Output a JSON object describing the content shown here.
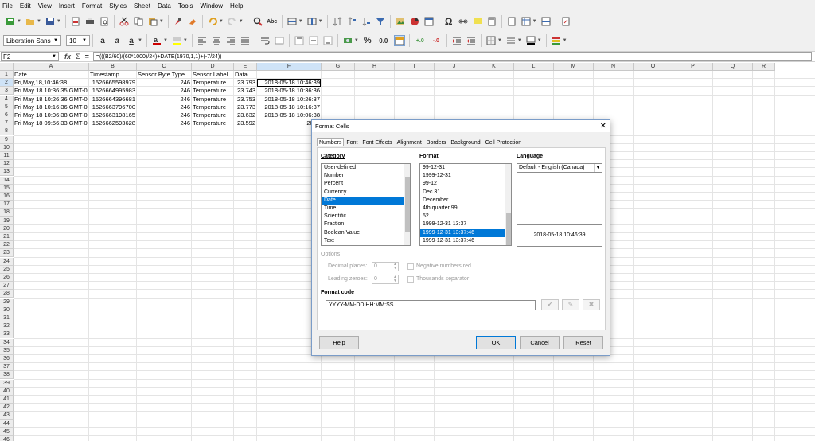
{
  "menu": [
    "File",
    "Edit",
    "View",
    "Insert",
    "Format",
    "Styles",
    "Sheet",
    "Data",
    "Tools",
    "Window",
    "Help"
  ],
  "toolbar": {
    "font_name": "Liberation Sans",
    "font_size": "10",
    "omega": "Ω",
    "percent": "%",
    "decimal": "0.0"
  },
  "formula_bar": {
    "cell_ref": "F2",
    "func_icon": "fx",
    "sum_icon": "Σ",
    "equals_icon": "=",
    "formula": "=(((B2/60)/(60*1000)/24)+DATE(1970,1,1)+(-7/24))"
  },
  "columns": [
    "A",
    "B",
    "C",
    "D",
    "E",
    "F",
    "G",
    "H",
    "I",
    "J",
    "K",
    "L",
    "M",
    "N",
    "O",
    "P",
    "Q",
    "R"
  ],
  "rows": [
    "1",
    "2",
    "3",
    "4",
    "5",
    "6",
    "7",
    "8",
    "9",
    "10",
    "11",
    "12",
    "13",
    "14",
    "15",
    "16",
    "17",
    "18",
    "19",
    "20",
    "21",
    "22",
    "23",
    "24",
    "25",
    "26",
    "27",
    "28",
    "29",
    "30",
    "31",
    "32",
    "33",
    "34",
    "35",
    "36",
    "37",
    "38",
    "39",
    "40",
    "41",
    "42",
    "43",
    "44",
    "45",
    "46"
  ],
  "sheet": {
    "headers": [
      "Date",
      "Timestamp",
      "Sensor Byte Type",
      "Sensor Label",
      "Data"
    ],
    "data": [
      [
        "Fri,May,18,10:46:38",
        "1526665598979",
        "246",
        "Temperature",
        "23.793",
        "2018-05-18 10:46:39"
      ],
      [
        "Fri May 18 10:36:35 GMT-0700 2018",
        "1526664995983",
        "246",
        "Temperature",
        "23.743",
        "2018-05-18 10:36:36"
      ],
      [
        "Fri May 18 10:26:36 GMT-0700 2018",
        "1526664396681",
        "246",
        "Temperature",
        "23.753",
        "2018-05-18 10:26:37"
      ],
      [
        "Fri May 18 10:16:36 GMT-0700 2018",
        "1526663796700",
        "246",
        "Temperature",
        "23.773",
        "2018-05-18 10:16:37"
      ],
      [
        "Fri May 18 10:06:38 GMT-0700 2018",
        "1526663198165",
        "246",
        "Temperature",
        "23.632",
        "2018-05-18 10:06:38"
      ],
      [
        "Fri May 18 09:56:33 GMT-0700 2018",
        "1526662593628",
        "246",
        "Temperature",
        "23.592",
        "2018"
      ]
    ]
  },
  "dialog": {
    "title": "Format Cells",
    "close": "✕",
    "tabs": [
      "Numbers",
      "Font",
      "Font Effects",
      "Alignment",
      "Borders",
      "Background",
      "Cell Protection"
    ],
    "category_label": "Category",
    "categories": [
      "User-defined",
      "Number",
      "Percent",
      "Currency",
      "Date",
      "Time",
      "Scientific",
      "Fraction",
      "Boolean Value",
      "Text"
    ],
    "format_label": "Format",
    "formats": [
      "99-12-31",
      "1999-12-31",
      "99-12",
      "Dec 31",
      "December",
      "4th quarter 99",
      "52",
      "1999-12-31 13:37",
      "1999-12-31 13:37:46",
      "1999-12-31 13:37:46"
    ],
    "language_label": "Language",
    "language_value": "Default - English (Canada)",
    "preview": "2018-05-18 10:46:39",
    "options_label": "Options",
    "decimal_label": "Decimal places:",
    "decimal_value": "0",
    "leading_label": "Leading zeroes:",
    "leading_value": "0",
    "negative_label": "Negative numbers red",
    "thousands_label": "Thousands separator",
    "format_code_label": "Format code",
    "format_code": "YYYY-MM-DD HH:MM:SS",
    "buttons": {
      "help": "Help",
      "ok": "OK",
      "cancel": "Cancel",
      "reset": "Reset"
    }
  }
}
